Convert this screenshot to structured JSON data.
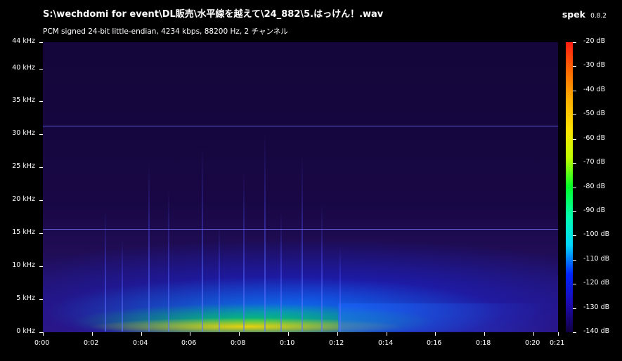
{
  "window": {
    "title": "S:\\wechdomi for event\\DL販売\\水平線を越えて\\24_882\\5.はっけん！.wav",
    "subtitle": "PCM signed 24-bit little-endian, 4234 kbps, 88200 Hz, 2 チャンネル",
    "brand": {
      "name": "spek",
      "version": "0.8.2"
    }
  },
  "spectrogram": {
    "frequency_axis_labels": [
      "44 kHz",
      "40 kHz",
      "35 kHz",
      "30 kHz",
      "25 kHz",
      "20 kHz",
      "15 kHz",
      "10 kHz",
      "5 kHz",
      "0 kHz"
    ],
    "time_axis_labels": [
      "0:00",
      "0:02",
      "0:04",
      "0:06",
      "0:08",
      "0:10",
      "0:12",
      "0:14",
      "0:16",
      "0:18",
      "0:20",
      "0:21"
    ],
    "db_scale_labels": [
      "-20 dB",
      "-30 dB",
      "-40 dB",
      "-50 dB",
      "-60 dB",
      "-70 dB",
      "-80 dB",
      "-90 dB",
      "-100 dB",
      "-110 dB",
      "-120 dB",
      "-130 dB",
      "-140 dB"
    ],
    "frequency_range_khz": [
      0,
      44
    ],
    "time_range_s": [
      0,
      21
    ],
    "db_range": [
      -140,
      -20
    ],
    "colors": {
      "background": "#000000",
      "spectrum_low": "#120042",
      "spectrum_mid": "#00ff2a",
      "spectrum_high": "#ff1c12"
    }
  }
}
